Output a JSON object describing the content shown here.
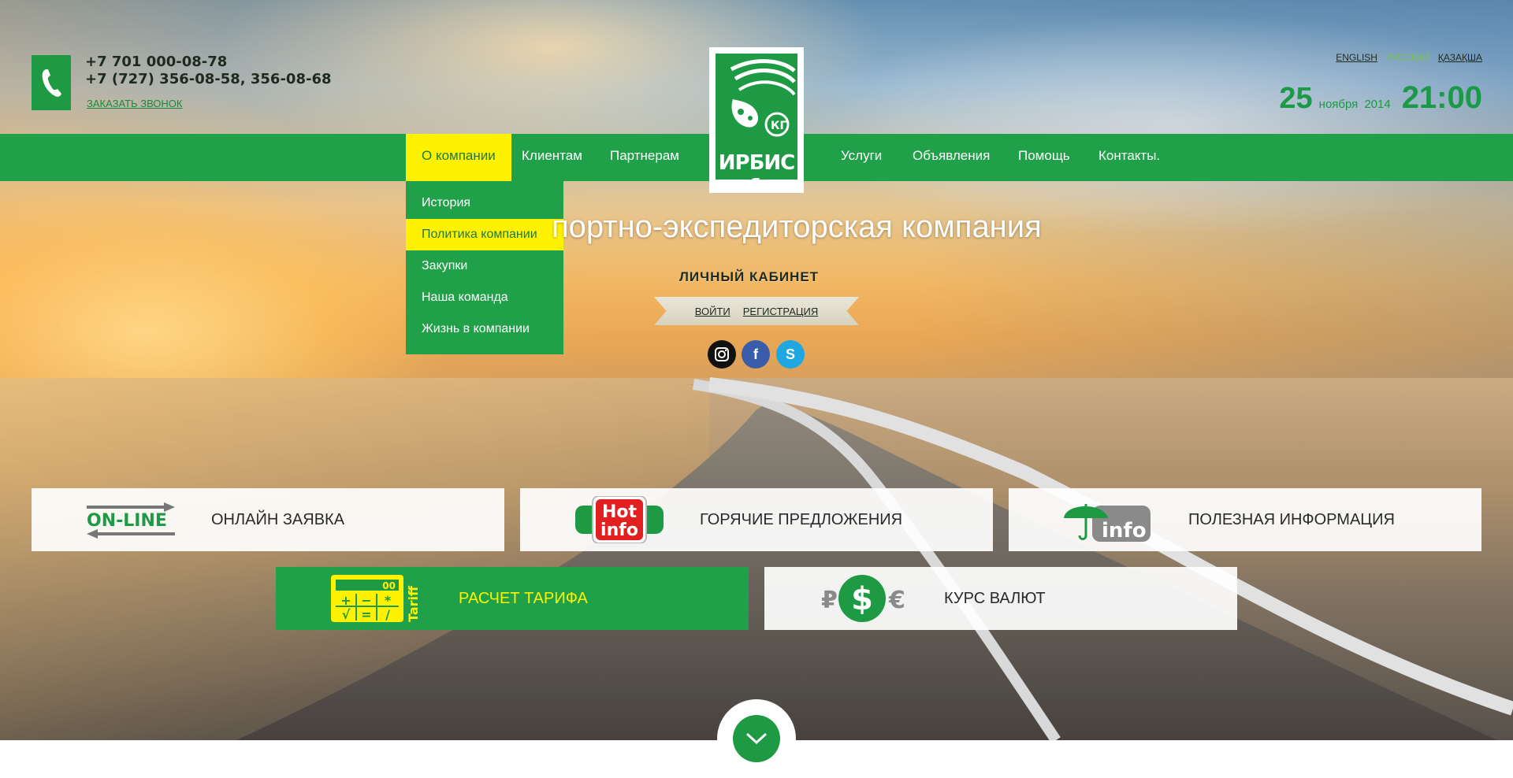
{
  "header": {
    "phone_primary": "+7 701 000-08-78",
    "phone_secondary": "+7 (727) 356-08-58, 356-08-68",
    "callback_link": "ЗАКАЗАТЬ ЗВОНОК",
    "languages": [
      {
        "label": "ENGLISH",
        "active": false
      },
      {
        "label": "РУССКИЙ",
        "active": true
      },
      {
        "label": "ҚАЗАҚША",
        "active": false
      }
    ],
    "date": {
      "day": "25",
      "month": "ноября",
      "year": "2014",
      "time": "21:00"
    }
  },
  "logo": {
    "text": "ИРБИС 1",
    "badge": "КГ"
  },
  "nav": {
    "left": [
      "О компании",
      "Клиентам",
      "Партнерам"
    ],
    "right": [
      "Услуги",
      "Объявления",
      "Помощь",
      "Контакты."
    ],
    "active": "О компании"
  },
  "dropdown": {
    "items": [
      "История",
      "Политика компании",
      "Закупки",
      "Наша команда",
      "Жизнь в компании"
    ],
    "active": "Политика компании"
  },
  "hero": {
    "title": "портно-экспедиторская компания",
    "cabinet_title": "ЛИЧНЫЙ КАБИНЕТ",
    "login": "ВОЙТИ",
    "register": "РЕГИСТРАЦИЯ"
  },
  "social": [
    {
      "name": "instagram-icon"
    },
    {
      "name": "facebook-icon",
      "glyph": "f"
    },
    {
      "name": "skype-icon",
      "glyph": "S"
    }
  ],
  "tiles": {
    "online": {
      "icon_text": "ON-LINE",
      "label": "ОНЛАЙН ЗАЯВКА"
    },
    "hot": {
      "icon_text_1": "Hot",
      "icon_text_2": "info",
      "label": "ГОРЯЧИЕ ПРЕДЛОЖЕНИЯ"
    },
    "info": {
      "icon_text": "info",
      "label": "ПОЛЕЗНАЯ ИНФОРМАЦИЯ"
    },
    "tariff": {
      "icon_text": "Tariff",
      "display": "00",
      "keys": [
        "+",
        "−",
        "*",
        "√",
        "=",
        "/"
      ],
      "label": "РАСЧЕТ ТАРИФА"
    },
    "currency": {
      "left_symbol": "₽",
      "center_symbol": "$",
      "right_symbol": "€",
      "label": "КУРС ВАЛЮТ"
    }
  },
  "colors": {
    "brand_green": "#21a04a",
    "accent_yellow": "#fff200"
  }
}
